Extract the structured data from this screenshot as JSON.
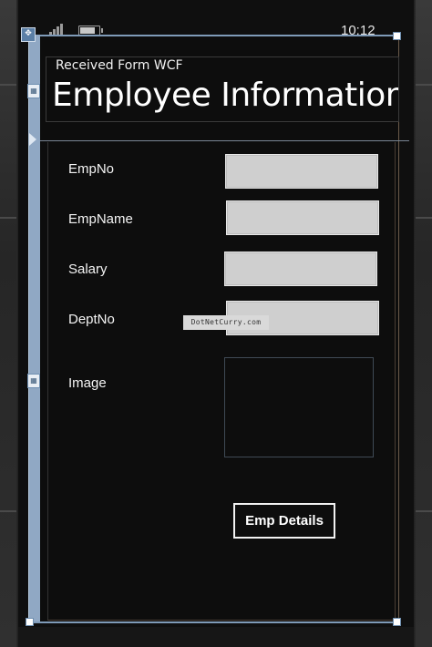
{
  "status_bar": {
    "time": "10:12",
    "icons": [
      "signal-icon",
      "battery-icon"
    ],
    "battery_level": 0.8
  },
  "header": {
    "app_title": "Received Form WCF",
    "page_title": "Employee Information"
  },
  "form": {
    "fields": [
      {
        "label": "EmpNo",
        "value": ""
      },
      {
        "label": "EmpName",
        "value": ""
      },
      {
        "label": "Salary",
        "value": ""
      },
      {
        "label": "DeptNo",
        "value": ""
      }
    ],
    "image_label": "Image",
    "button_label": "Emp Details"
  },
  "watermark": "DotNetCurry.com",
  "colors": {
    "background": "#0f0f0f",
    "textbox": "#cfcfcf",
    "text": "#ffffff",
    "selection_frame": "#7f9bb8"
  }
}
